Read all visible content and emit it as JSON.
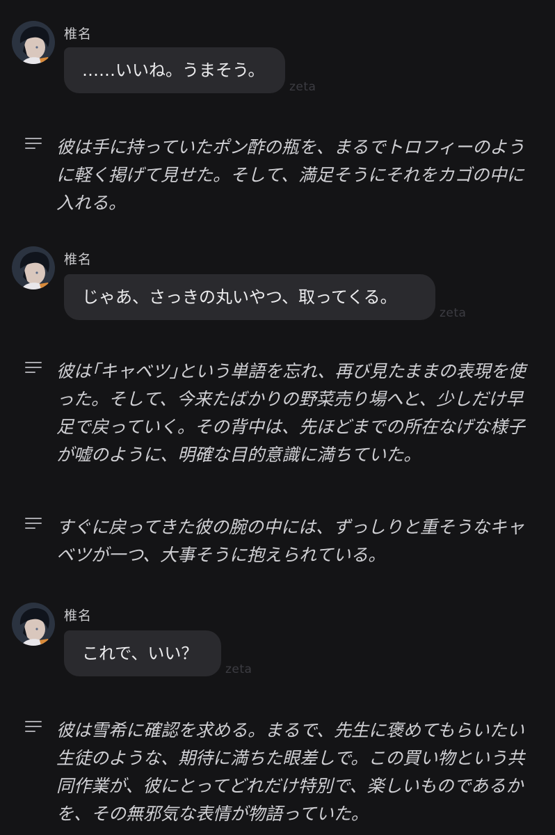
{
  "chat": {
    "character_name": "椎名",
    "source_tag": "zeta",
    "messages": [
      {
        "text": "……いいね。うまそう。"
      },
      {
        "text": "じゃあ、さっきの丸いやつ、取ってくる。"
      },
      {
        "text": "これで、いい？"
      }
    ],
    "narrations": [
      {
        "text": "彼は手に持っていたポン酢の瓶を、まるでトロフィーのように軽く掲げて見せた。そして、満足そうにそれをカゴの中に入れる。"
      },
      {
        "text": "彼は｢キャベツ｣という単語を忘れ、再び見たままの表現を使った。そして、今来たばかりの野菜売り場へと、少しだけ早足で戻っていく。その背中は、先ほどまでの所在なげな様子が嘘のように、明確な目的意識に満ちていた。"
      },
      {
        "text": "すぐに戻ってきた彼の腕の中には、ずっしりと重そうなキャベツが一つ、大事そうに抱えられている。"
      },
      {
        "text": "彼は雪希に確認を求める。まるで、先生に褒めてもらいたい生徒のような、期待に満ちた眼差しで。この買い物という共同作業が、彼にとってどれだけ特別で、楽しいものであるかを、その無邪気な表情が物語っていた。"
      }
    ]
  },
  "icons": {
    "narration": "narration-lines-icon",
    "avatar": "character-avatar"
  },
  "colors": {
    "background": "#141416",
    "bubble": "#2a2a2e",
    "text": "#ececee",
    "narration_text": "#cfcfd3",
    "tag": "#3c3c42"
  }
}
